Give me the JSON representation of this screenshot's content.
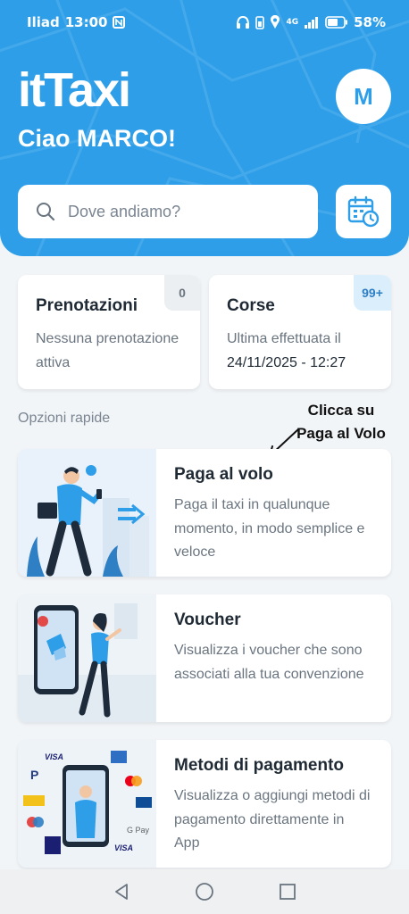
{
  "status_bar": {
    "carrier": "Iliad",
    "time": "13:00",
    "network": "4G",
    "battery": "58%"
  },
  "header": {
    "logo": "itTaxi",
    "greeting": "Ciao MARCO!",
    "avatar_initial": "M",
    "search_placeholder": "Dove andiamo?"
  },
  "summary": {
    "prenotazioni": {
      "title": "Prenotazioni",
      "count": "0",
      "description": "Nessuna prenotazione attiva"
    },
    "corse": {
      "title": "Corse",
      "count": "99+",
      "description_line1": "Ultima effettuata il",
      "description_line2": "24/11/2025 - 12:27"
    }
  },
  "quick_options": {
    "section_title": "Opzioni rapide",
    "annotation": "Clicca su Paga al Volo",
    "items": [
      {
        "title": "Paga al volo",
        "description": "Paga il taxi in qualunque momento, in modo semplice e veloce",
        "illustration": "person-walking-phone-illustration"
      },
      {
        "title": "Voucher",
        "description": "Visualizza i voucher che sono associati alla tua convenzione",
        "illustration": "voucher-phone-illustration"
      },
      {
        "title": "Metodi di pagamento",
        "description": "Visualizza o aggiungi metodi di pagamento direttamente in App",
        "illustration": "payment-methods-illustration",
        "brands": [
          "VISA",
          "PayPal",
          "Mastercard",
          "Maestro",
          "JCB",
          "G Pay",
          "V PAY",
          "AMEX"
        ]
      }
    ]
  },
  "colors": {
    "brand_blue": "#2e9ee8",
    "background": "#f2f5f8",
    "card": "#ffffff",
    "text_dark": "#1f2a35",
    "text_muted": "#6a7580"
  },
  "navbar": {
    "icons": [
      "back-icon",
      "home-icon",
      "recents-icon"
    ]
  }
}
